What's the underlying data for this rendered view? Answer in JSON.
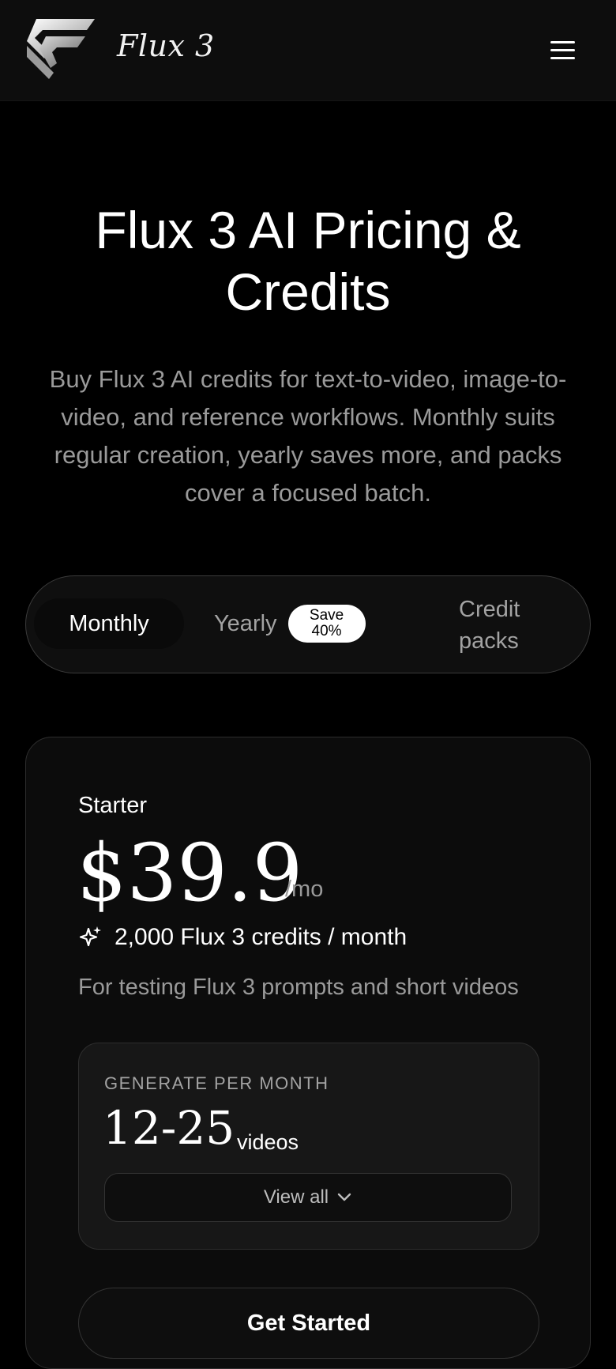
{
  "header": {
    "brand": "Flux 3",
    "logo_icon": "flux-logo-icon",
    "menu_icon": "hamburger-menu-icon"
  },
  "hero": {
    "title": "Flux 3 AI Pricing & Credits",
    "subtitle": "Buy Flux 3 AI credits for text-to-video, image-to-video, and reference workflows. Monthly suits regular creation, yearly saves more, and packs cover a focused batch."
  },
  "billing_toggle": {
    "monthly_label": "Monthly",
    "yearly_label": "Yearly",
    "save_badge_line1": "Save",
    "save_badge_line2": "40%",
    "packs_label": "Credit packs",
    "selected": "Monthly"
  },
  "plan": {
    "name": "Starter",
    "price": "$39.9",
    "period": "/mo",
    "credits": "2,000 Flux 3 credits / month",
    "credits_icon": "sparkle-icon",
    "description": "For testing Flux 3 prompts and short videos",
    "generate_label": "GENERATE PER MONTH",
    "generate_range": "12-25",
    "generate_unit": "videos",
    "view_all_label": "View all",
    "cta_label": "Get Started"
  },
  "colors": {
    "background": "#000000",
    "header_bg": "#0d0d0d",
    "card_bg": "#0c0c0c",
    "muted_text": "#9a9a9a",
    "badge_bg": "#ffffff"
  }
}
